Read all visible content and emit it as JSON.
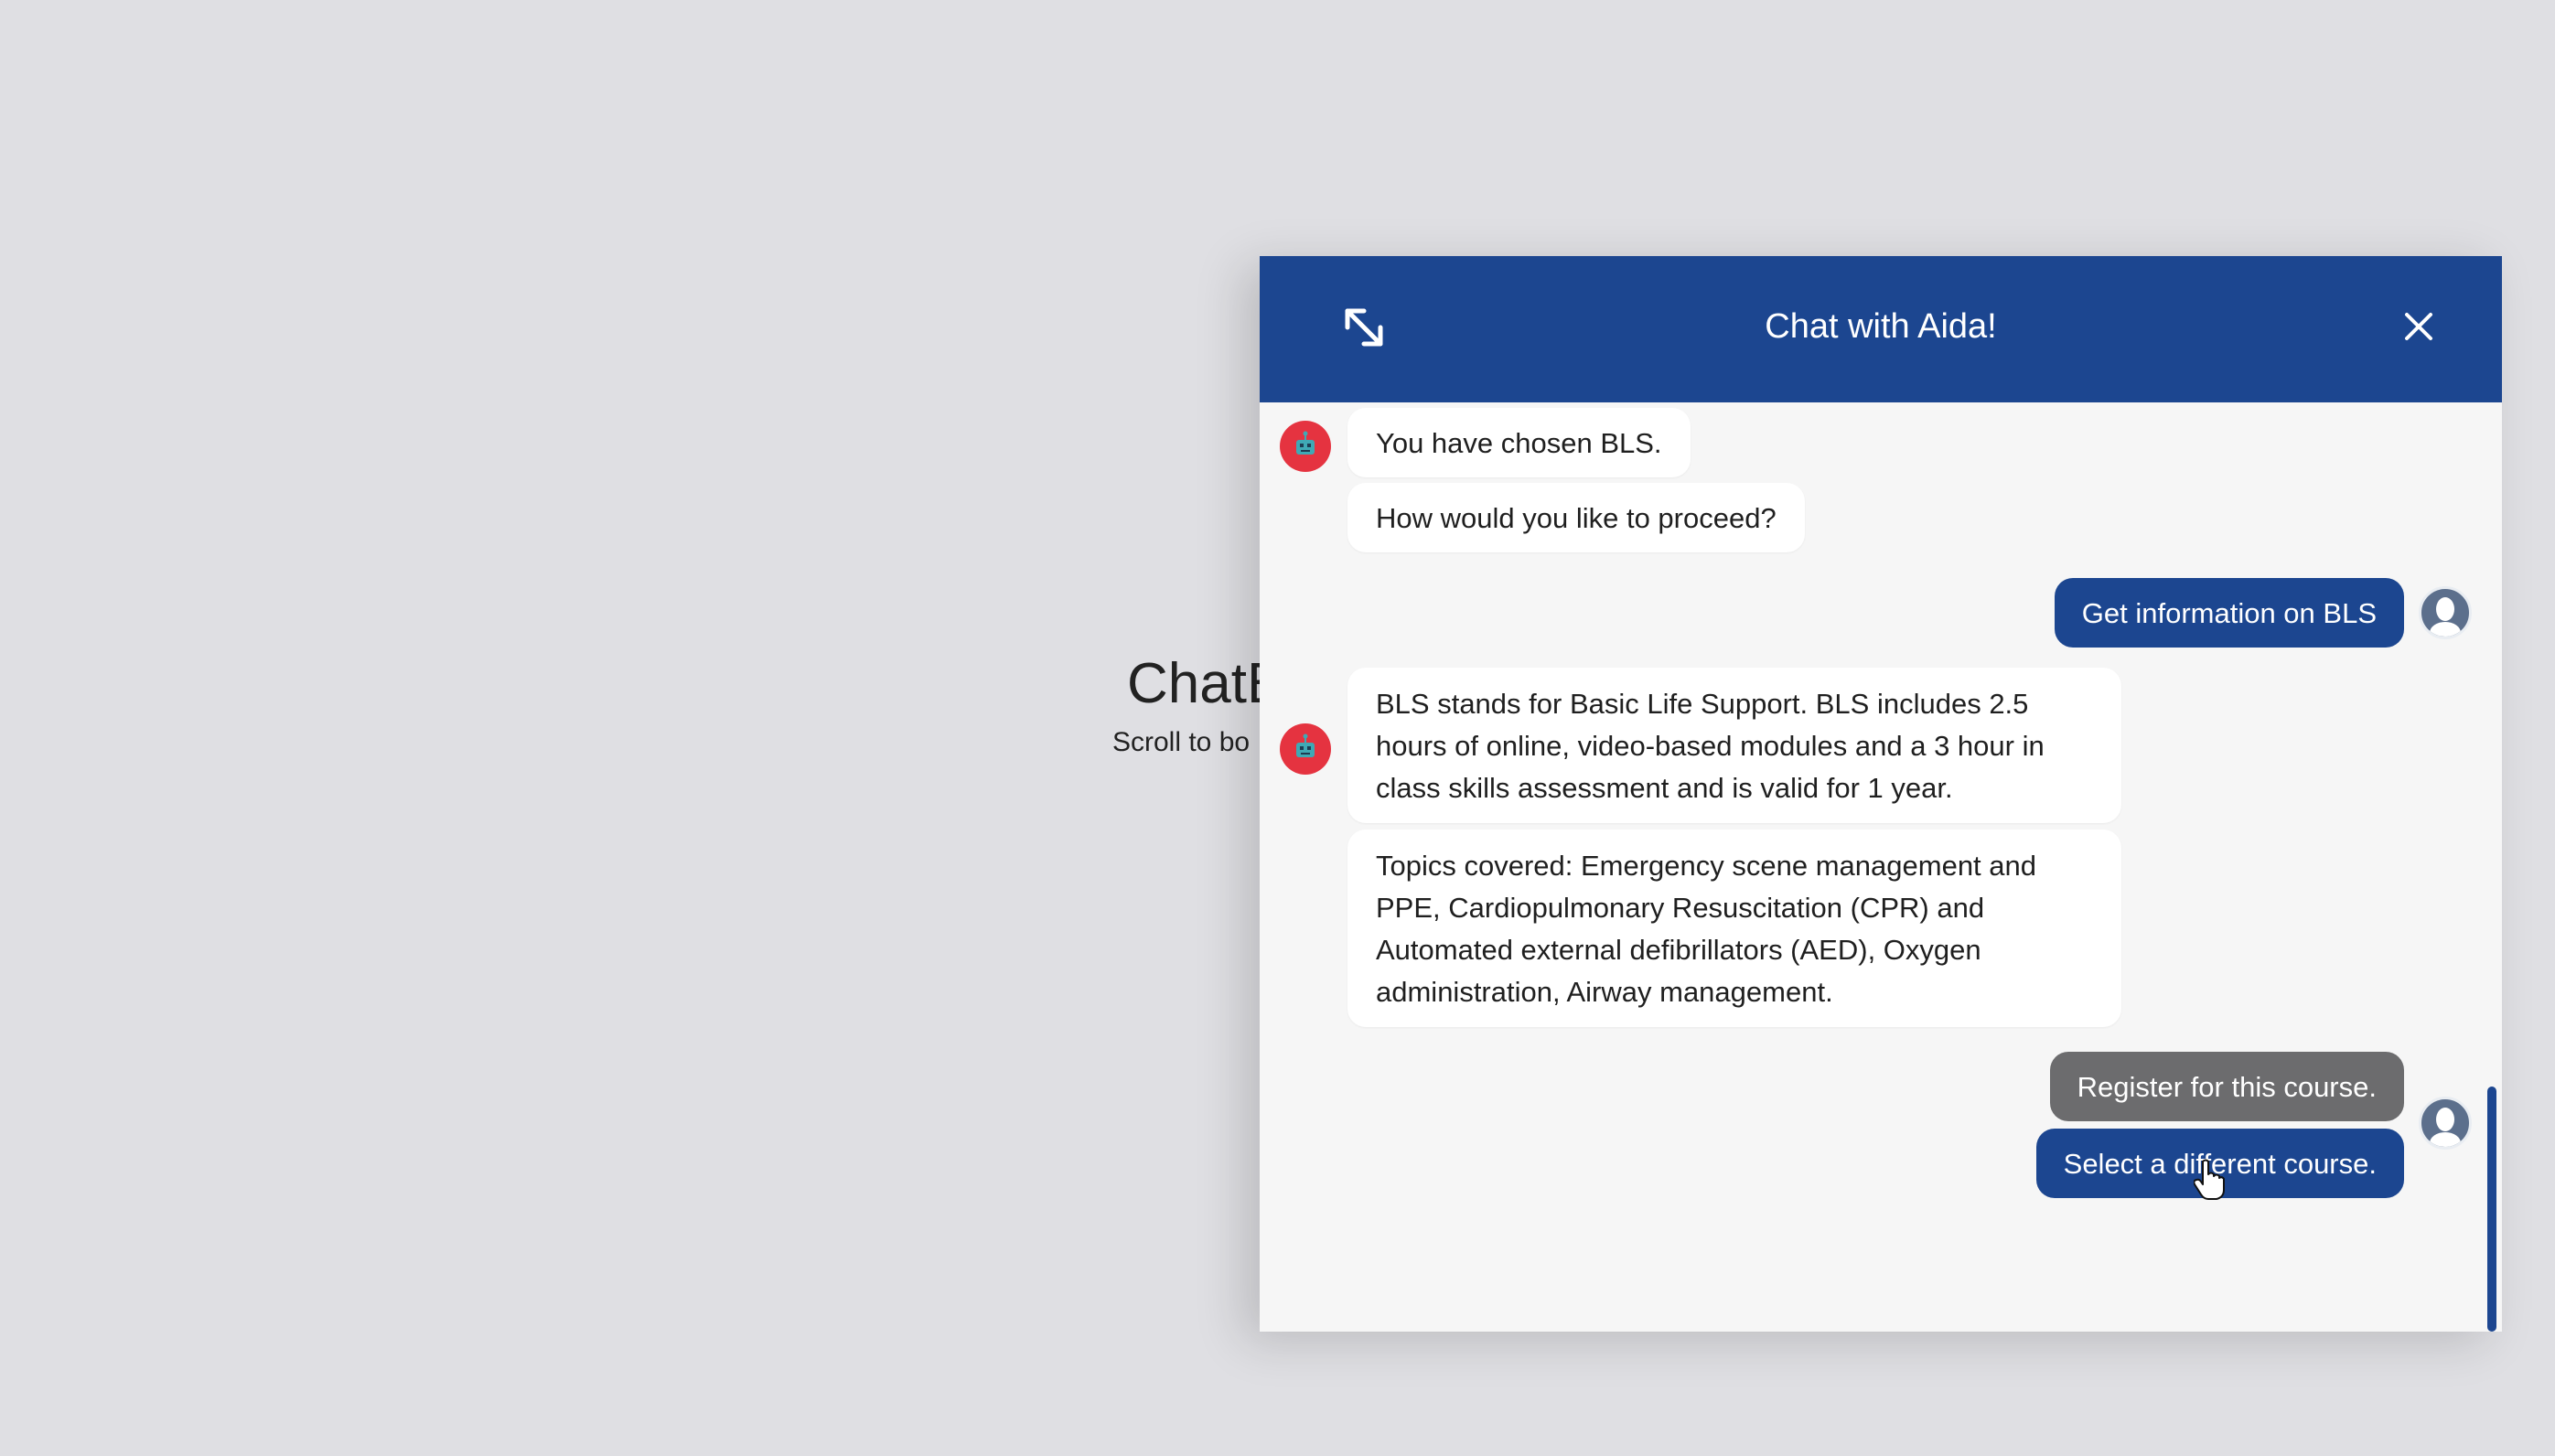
{
  "background": {
    "title": "ChatB",
    "subtitle": "Scroll to bo"
  },
  "chat": {
    "header": {
      "title": "Chat with Aida!",
      "expand_icon": "expand-arrows-icon",
      "close_icon": "close-icon"
    },
    "messages": {
      "bot1_line1": "You have chosen BLS.",
      "bot1_line2": "How would you like to proceed?",
      "user1": "Get information on BLS",
      "bot2_para1": "BLS stands for Basic Life Support. BLS includes 2.5 hours of online, video-based modules and a 3 hour in class skills assessment and is valid for 1 year.",
      "bot2_para2": "Topics covered: Emergency scene management and PPE, Cardiopulmonary Resuscitation (CPR) and Automated external defibrillators (AED), Oxygen administration, Airway management."
    },
    "options": {
      "register": "Register for this course.",
      "select_different": "Select a different course."
    }
  },
  "colors": {
    "header": "#1c4690",
    "user_bubble": "#1c4690",
    "option_gray": "#6c6c6e",
    "bot_avatar": "#e53340",
    "page_bg": "#dfdfe3"
  }
}
